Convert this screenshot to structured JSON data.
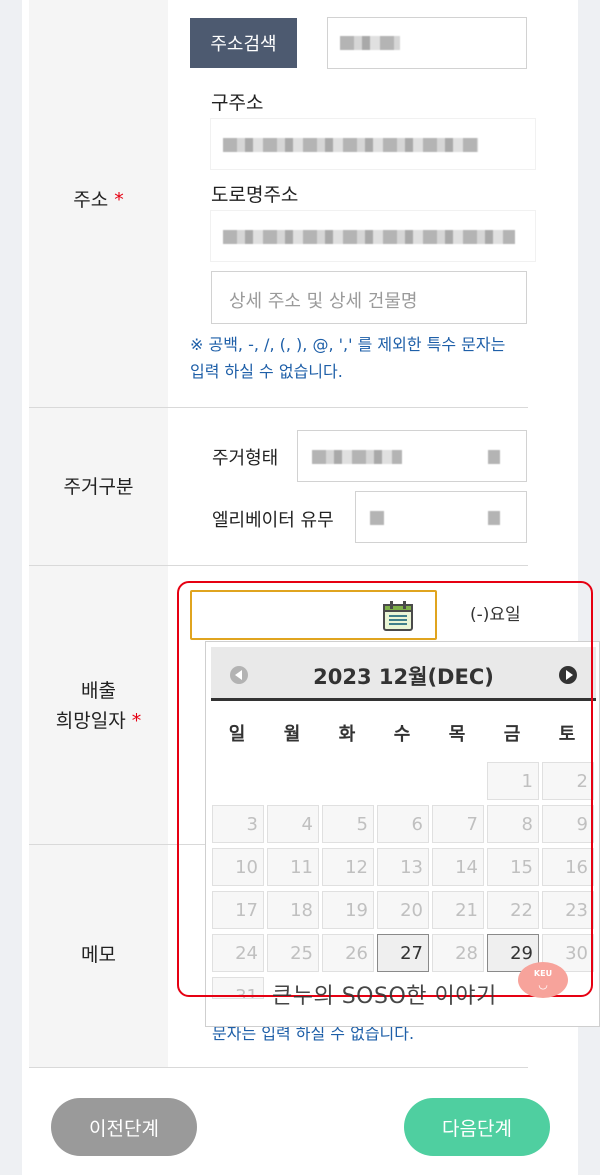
{
  "address": {
    "label": "주소",
    "required_mark": "*",
    "search_button": "주소검색",
    "old_address_label": "구주소",
    "road_address_label": "도로명주소",
    "detail_placeholder": "상세 주소 및 상세 건물명",
    "notice": "※ 공백, -, /, (, ), @, ',' 를 제외한 특수 문자는 입력 하실 수 없습니다."
  },
  "residence": {
    "label": "주거구분",
    "type_label": "주거형태",
    "elevator_label": "엘리베이터 유무"
  },
  "delivery": {
    "label_line1": "배출",
    "label_line2": "희망일자",
    "required_mark": "*",
    "weekday_text": "(-)요일"
  },
  "calendar": {
    "title": "2023 12월(DEC)",
    "weekdays": [
      "일",
      "월",
      "화",
      "수",
      "목",
      "금",
      "토"
    ],
    "days": [
      "1",
      "2",
      "3",
      "4",
      "5",
      "6",
      "7",
      "8",
      "9",
      "10",
      "11",
      "12",
      "13",
      "14",
      "15",
      "16",
      "17",
      "18",
      "19",
      "20",
      "21",
      "22",
      "23",
      "24",
      "25",
      "26",
      "27",
      "28",
      "29",
      "30",
      "31"
    ],
    "active_days": [
      "27",
      "29"
    ]
  },
  "memo": {
    "label": "메모",
    "notice_fragment": "문자는 입력 하실 수 없습니다."
  },
  "watermark": {
    "text": "큰누의 SOSO한 이야기",
    "logo_text": "KEU"
  },
  "footer": {
    "prev_button": "이전단계",
    "next_button": "다음단계"
  }
}
